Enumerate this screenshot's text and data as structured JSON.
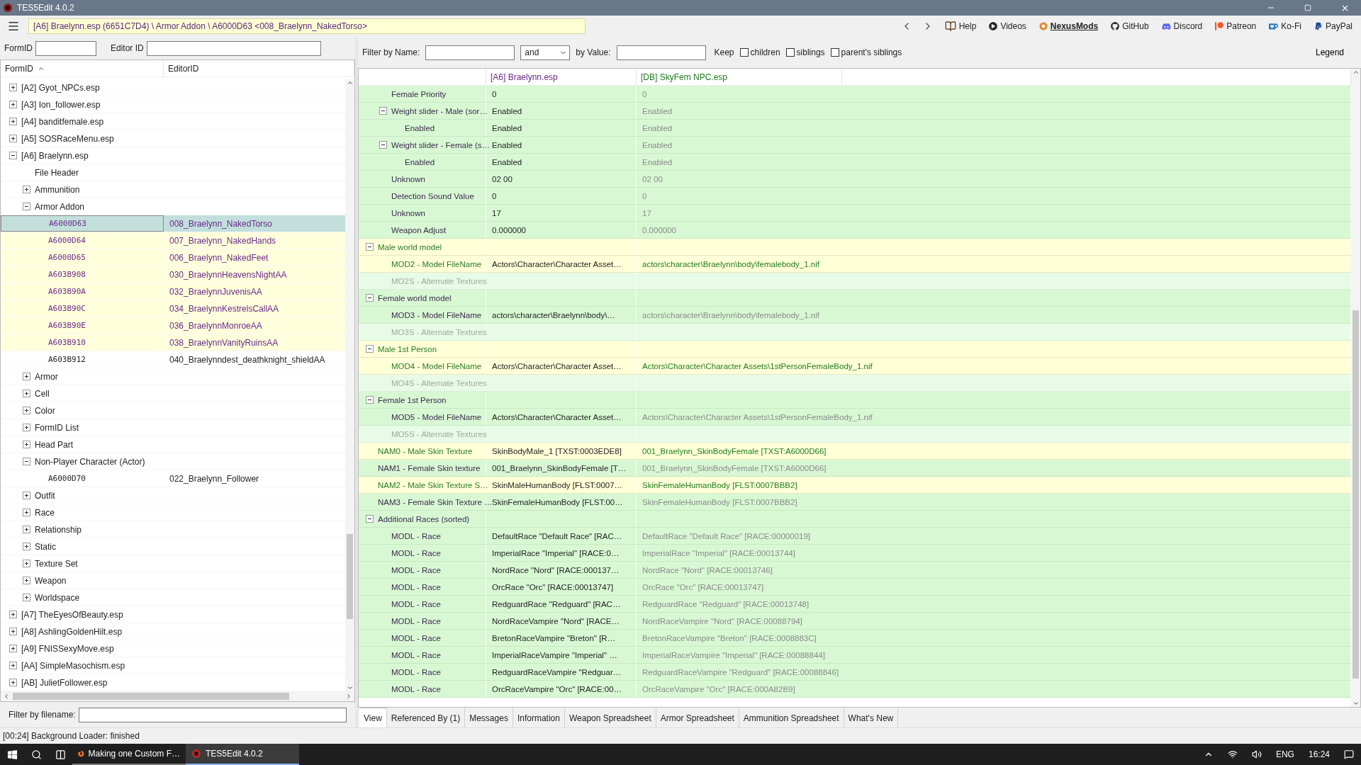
{
  "window": {
    "title": "TES5Edit 4.0.2"
  },
  "toolbar": {
    "path": "[A6] Braelynn.esp (6651C7D4) \\ Armor Addon \\ A6000D63 <008_Braelynn_NakedTorso>",
    "links": [
      {
        "kind": "help",
        "label": "Help",
        "emphasized": false
      },
      {
        "kind": "videos",
        "label": "Videos",
        "emphasized": false
      },
      {
        "kind": "nexus",
        "label": "NexusMods",
        "emphasized": true
      },
      {
        "kind": "github",
        "label": "GitHub",
        "emphasized": false
      },
      {
        "kind": "discord",
        "label": "Discord",
        "emphasized": false
      },
      {
        "kind": "patreon",
        "label": "Patreon",
        "emphasized": false
      },
      {
        "kind": "kofi",
        "label": "Ko-Fi",
        "emphasized": false
      },
      {
        "kind": "paypal",
        "label": "PayPal",
        "emphasized": false
      }
    ]
  },
  "left_panel": {
    "formid_label": "FormID",
    "editorid_label": "Editor ID",
    "columns": [
      "FormID",
      "EditorID"
    ],
    "tree": [
      {
        "label": "[A2] Gyot_NPCs.esp",
        "expanded": false,
        "selected": false
      },
      {
        "label": "[A3] Ion_follower.esp",
        "expanded": false,
        "selected": false
      },
      {
        "label": "[A4] banditfemale.esp",
        "expanded": false,
        "selected": false
      },
      {
        "label": "[A5] SOSRaceMenu.esp",
        "expanded": false,
        "selected": false
      },
      {
        "label": "[A6] Braelynn.esp",
        "expanded": true,
        "selected": false,
        "children": [
          {
            "label": "File Header",
            "selected": false
          },
          {
            "label": "Ammunition",
            "expanded": false,
            "selected": false
          },
          {
            "label": "Armor Addon",
            "expanded": true,
            "selected": false,
            "children": [
              {
                "form_id": "A6000D63",
                "editor_id": "008_Braelynn_NakedTorso",
                "conflict": true,
                "selected": true
              },
              {
                "form_id": "A6000D64",
                "editor_id": "007_Braelynn_NakedHands",
                "conflict": true,
                "selected": false
              },
              {
                "form_id": "A6000D65",
                "editor_id": "006_Braelynn_NakedFeet",
                "conflict": true,
                "selected": false
              },
              {
                "form_id": "A603B908",
                "editor_id": "030_BraelynnHeavensNightAA",
                "conflict": true,
                "selected": false
              },
              {
                "form_id": "A603B90A",
                "editor_id": "032_BraelynnJuvenisAA",
                "conflict": true,
                "selected": false
              },
              {
                "form_id": "A603B90C",
                "editor_id": "034_BraelynnKestrelsCallAA",
                "conflict": true,
                "selected": false
              },
              {
                "form_id": "A603B90E",
                "editor_id": "036_BraelynnMonroeAA",
                "conflict": true,
                "selected": false
              },
              {
                "form_id": "A603B910",
                "editor_id": "038_BraelynnVanityRuinsAA",
                "conflict": true,
                "selected": false
              },
              {
                "form_id": "A603B912",
                "editor_id": "040_Braelynndest_deathknight_shieldAA",
                "conflict": false,
                "selected": false
              }
            ]
          },
          {
            "label": "Armor",
            "expanded": false,
            "selected": false
          },
          {
            "label": "Cell",
            "expanded": false,
            "selected": false
          },
          {
            "label": "Color",
            "expanded": false,
            "selected": false
          },
          {
            "label": "FormID List",
            "expanded": false,
            "selected": false
          },
          {
            "label": "Head Part",
            "expanded": false,
            "selected": false
          },
          {
            "label": "Non-Player Character (Actor)",
            "expanded": true,
            "selected": false,
            "children": [
              {
                "form_id": "A6000D70",
                "editor_id": "022_Braelynn_Follower",
                "conflict": false,
                "selected": false
              }
            ]
          },
          {
            "label": "Outfit",
            "expanded": false,
            "selected": false
          },
          {
            "label": "Race",
            "expanded": false,
            "selected": false
          },
          {
            "label": "Relationship",
            "expanded": false,
            "selected": false
          },
          {
            "label": "Static",
            "expanded": false,
            "selected": false
          },
          {
            "label": "Texture Set",
            "expanded": false,
            "selected": false
          },
          {
            "label": "Weapon",
            "expanded": false,
            "selected": false
          },
          {
            "label": "Worldspace",
            "expanded": false,
            "selected": false
          }
        ]
      },
      {
        "label": "[A7] TheEyesOfBeauty.esp",
        "expanded": false,
        "selected": false
      },
      {
        "label": "[A8] AshlingGoldenHilt.esp",
        "expanded": false,
        "selected": false
      },
      {
        "label": "[A9] FNISSexyMove.esp",
        "expanded": false,
        "selected": false
      },
      {
        "label": "[AA] SimpleMasochism.esp",
        "expanded": false,
        "selected": false
      },
      {
        "label": "[AB] JulietFollower.esp",
        "expanded": false,
        "selected": false
      }
    ],
    "filename_filter_label": "Filter by filename:"
  },
  "right_panel": {
    "filter": {
      "name_label": "Filter by Name:",
      "operator": "and",
      "value_label": "by Value:",
      "keep_label": "Keep",
      "options": [
        {
          "label": "children",
          "checked": false
        },
        {
          "label": "siblings",
          "checked": false
        },
        {
          "label": "parent's siblings",
          "checked": false
        }
      ],
      "legend": "Legend"
    },
    "columns": [
      {
        "label": "[A6] Braelynn.esp",
        "color": "#6a2a8a"
      },
      {
        "label": "[DB] SkyFem NPC.esp",
        "color": "#1e7d1e"
      }
    ],
    "fields": [
      {
        "kind": "continuation",
        "children": [
          {
            "label": "Female Priority",
            "value_1": "0",
            "value_2": "0",
            "conflict": false
          },
          {
            "label": "Weight slider - Male (sor…",
            "value_1": "Enabled",
            "value_2": "Enabled",
            "conflict": false,
            "expanded": true,
            "children": [
              {
                "label": "Enabled",
                "value_1": "Enabled",
                "value_2": "Enabled",
                "conflict": false
              }
            ]
          },
          {
            "label": "Weight slider - Female (s…",
            "value_1": "Enabled",
            "value_2": "Enabled",
            "conflict": false,
            "expanded": true,
            "children": [
              {
                "label": "Enabled",
                "value_1": "Enabled",
                "value_2": "Enabled",
                "conflict": false
              }
            ]
          },
          {
            "label": "Unknown",
            "value_1": "02 00",
            "value_2": "02 00",
            "conflict": false
          },
          {
            "label": "Detection Sound Value",
            "value_1": "0",
            "value_2": "0",
            "conflict": false
          },
          {
            "label": "Unknown",
            "value_1": "17",
            "value_2": "17",
            "conflict": false
          },
          {
            "label": "Weapon Adjust",
            "value_1": "0.000000",
            "value_2": "0.000000",
            "conflict": false
          }
        ]
      },
      {
        "kind": "field",
        "label": "Male world model",
        "conflict": true,
        "expanded": true,
        "children": [
          {
            "label": "MOD2 - Model FileName",
            "value_1": "Actors\\Character\\Character Asset…",
            "value_2": "actors\\character\\Braelynn\\body\\femalebody_1.nif",
            "conflict": true
          },
          {
            "label": "MO2S - Alternate Textures"
          }
        ]
      },
      {
        "kind": "field",
        "label": "Female world model",
        "conflict": false,
        "expanded": true,
        "children": [
          {
            "label": "MOD3 - Model FileName",
            "value_1": "actors\\character\\Braelynn\\body\\…",
            "value_2": "actors\\character\\Braelynn\\body\\femalebody_1.nif",
            "conflict": false
          },
          {
            "label": "MO3S - Alternate Textures"
          }
        ]
      },
      {
        "kind": "field",
        "label": "Male 1st Person",
        "conflict": true,
        "expanded": true,
        "children": [
          {
            "label": "MOD4 - Model FileName",
            "value_1": "Actors\\Character\\Character Asset…",
            "value_2": "Actors\\Character\\Character Assets\\1stPersonFemaleBody_1.nif",
            "conflict": true
          },
          {
            "label": "MO4S - Alternate Textures"
          }
        ]
      },
      {
        "kind": "field",
        "label": "Female 1st Person",
        "conflict": false,
        "expanded": true,
        "children": [
          {
            "label": "MOD5 - Model FileName",
            "value_1": "Actors\\Character\\Character Asset…",
            "value_2": "Actors\\Character\\Character Assets\\1stPersonFemaleBody_1.nif",
            "conflict": false
          },
          {
            "label": "MO5S - Alternate Textures"
          }
        ]
      },
      {
        "kind": "field",
        "label": "NAM0 - Male Skin Texture",
        "value_1": "SkinBodyMale_1 [TXST:0003EDE8]",
        "value_2": "001_Braelynn_SkinBodyFemale [TXST:A6000D66]",
        "conflict": true
      },
      {
        "kind": "field",
        "label": "NAM1 - Female Skin texture",
        "value_1": "001_Braelynn_SkinBodyFemale [T…",
        "value_2": "001_Braelynn_SkinBodyFemale [TXST:A6000D66]",
        "conflict": false
      },
      {
        "kind": "field",
        "label": "NAM2 - Male Skin Texture S…",
        "value_1": "SkinMaleHumanBody [FLST:0007…",
        "value_2": "SkinFemaleHumanBody [FLST:0007BBB2]",
        "conflict": true
      },
      {
        "kind": "field",
        "label": "NAM3 - Female Skin Texture …",
        "value_1": "SkinFemaleHumanBody [FLST:00…",
        "value_2": "SkinFemaleHumanBody [FLST:0007BBB2]",
        "conflict": false
      },
      {
        "kind": "field",
        "label": "Additional Races (sorted)",
        "conflict": false,
        "expanded": true,
        "children": [
          {
            "label": "MODL - Race",
            "value_1": "DefaultRace \"Default Race\" [RAC…",
            "value_2": "DefaultRace \"Default Race\" [RACE:00000019]",
            "conflict": false
          },
          {
            "label": "MODL - Race",
            "value_1": "ImperialRace \"Imperial\" [RACE:0…",
            "value_2": "ImperialRace \"Imperial\" [RACE:00013744]",
            "conflict": false
          },
          {
            "label": "MODL - Race",
            "value_1": "NordRace \"Nord\" [RACE:000137…",
            "value_2": "NordRace \"Nord\" [RACE:00013746]",
            "conflict": false
          },
          {
            "label": "MODL - Race",
            "value_1": "OrcRace \"Orc\" [RACE:00013747]",
            "value_2": "OrcRace \"Orc\" [RACE:00013747]",
            "conflict": false
          },
          {
            "label": "MODL - Race",
            "value_1": "RedguardRace \"Redguard\" [RAC…",
            "value_2": "RedguardRace \"Redguard\" [RACE:00013748]",
            "conflict": false
          },
          {
            "label": "MODL - Race",
            "value_1": "NordRaceVampire \"Nord\" [RACE…",
            "value_2": "NordRaceVampire \"Nord\" [RACE:00088794]",
            "conflict": false
          },
          {
            "label": "MODL - Race",
            "value_1": "BretonRaceVampire \"Breton\" [R…",
            "value_2": "BretonRaceVampire \"Breton\" [RACE:0008883C]",
            "conflict": false
          },
          {
            "label": "MODL - Race",
            "value_1": "ImperialRaceVampire \"Imperial\" …",
            "value_2": "ImperialRaceVampire \"Imperial\" [RACE:00088844]",
            "conflict": false
          },
          {
            "label": "MODL - Race",
            "value_1": "RedguardRaceVampire \"Redguar…",
            "value_2": "RedguardRaceVampire \"Redguard\" [RACE:00088846]",
            "conflict": false
          },
          {
            "label": "MODL - Race",
            "value_1": "OrcRaceVampire \"Orc\" [RACE:00…",
            "value_2": "OrcRaceVampire \"Orc\" [RACE:000A82B9]",
            "conflict": false
          }
        ]
      }
    ],
    "tabs": [
      {
        "label": "View",
        "selected": true
      },
      {
        "label": "Referenced By (1)",
        "selected": false
      },
      {
        "label": "Messages",
        "selected": false
      },
      {
        "label": "Information",
        "selected": false
      },
      {
        "label": "Weapon Spreadsheet",
        "selected": false
      },
      {
        "label": "Armor Spreadsheet",
        "selected": false
      },
      {
        "label": "Ammunition Spreadsheet",
        "selected": false
      },
      {
        "label": "What's New",
        "selected": false
      }
    ]
  },
  "status_bar": "[00:24] Background Loader: finished",
  "taskbar": {
    "windows": [
      {
        "kind": "browser",
        "label": "Making one Custom F…",
        "selected": false
      },
      {
        "kind": "app",
        "label": "TES5Edit 4.0.2",
        "selected": true
      }
    ],
    "language": "ENG",
    "time": "16:24"
  }
}
